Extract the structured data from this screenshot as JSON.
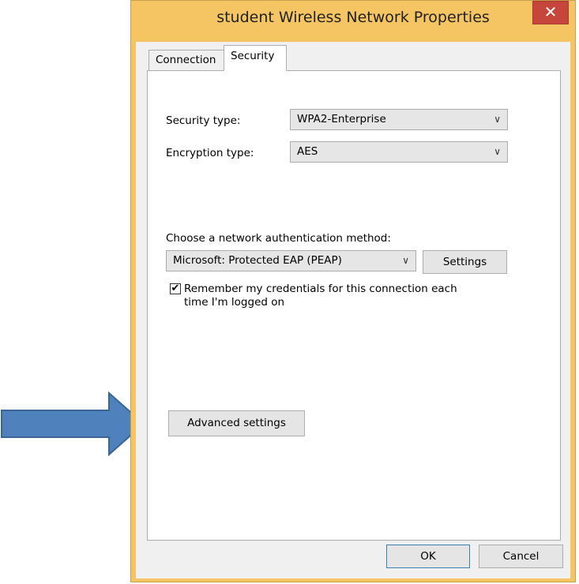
{
  "window": {
    "title": "student Wireless Network Properties",
    "close_label": "✕"
  },
  "tabs": [
    {
      "label": "Connection",
      "selected": false
    },
    {
      "label": "Security",
      "selected": true
    }
  ],
  "security": {
    "security_type_label": "Security type:",
    "security_type_value": "WPA2-Enterprise",
    "encryption_type_label": "Encryption type:",
    "encryption_type_value": "AES",
    "auth_method_label": "Choose a network authentication method:",
    "auth_method_value": "Microsoft: Protected EAP (PEAP)",
    "settings_button": "Settings",
    "remember_credentials_label": "Remember my credentials for this connection each time I'm logged on",
    "remember_credentials_checked": true,
    "advanced_settings_button": "Advanced settings"
  },
  "footer": {
    "ok_label": "OK",
    "cancel_label": "Cancel"
  },
  "icons": {
    "dropdown": "chevron-down-icon",
    "annotation": "arrow-right-icon"
  },
  "colors": {
    "title_bar": "#f5c564",
    "close_button": "#c7463c",
    "annotation_arrow": "#4f81bd"
  }
}
